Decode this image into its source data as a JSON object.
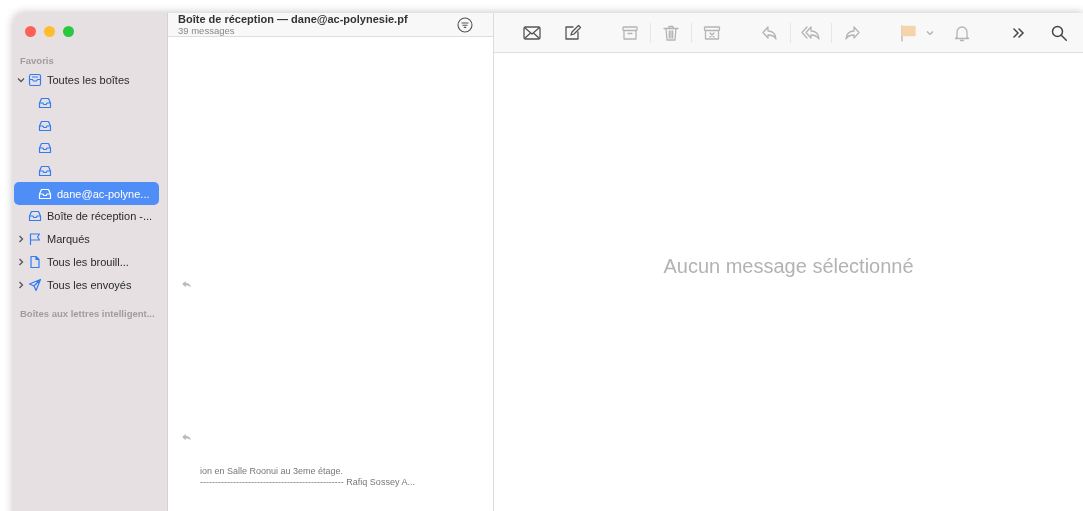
{
  "window": {
    "controls": [
      {
        "color": "#fe5f57"
      },
      {
        "color": "#febc2e"
      },
      {
        "color": "#28c840"
      }
    ]
  },
  "sidebar": {
    "section": "Favoris",
    "items": [
      {
        "kind": "all-inboxes",
        "label": "Toutes les boîtes",
        "expanded": true,
        "selected": false,
        "children": [
          {
            "selected": false
          },
          {
            "selected": false
          },
          {
            "selected": false
          },
          {
            "selected": false
          },
          {
            "label": "dane@ac-polyne...",
            "selected": true
          }
        ]
      },
      {
        "kind": "inbox",
        "label": "Boîte de réception -...",
        "selected": false
      },
      {
        "kind": "flag",
        "label": "Marqués",
        "expanded": false,
        "selected": false
      },
      {
        "kind": "draft",
        "label": "Tous les brouill...",
        "expanded": false,
        "selected": false
      },
      {
        "kind": "sent",
        "label": "Tous les envoyés",
        "expanded": false,
        "selected": false
      }
    ],
    "section_2": "Boîtes aux lettres intelligent..."
  },
  "message_list": {
    "title": "Boîte de réception — dane@ac-polynesie.pf",
    "count": "39 messages",
    "messages": [
      {
        "replied": true
      },
      {
        "replied": true,
        "preview": [
          "ion en Salle Roonui au 3eme étage.",
          "------------------------------------------------ Rafiq Sossey A..."
        ]
      }
    ]
  },
  "toolbar": [
    {
      "kind": "get-mail",
      "disabled": false
    },
    {
      "kind": "compose",
      "disabled": false
    },
    {
      "kind": "archive",
      "disabled": true
    },
    {
      "kind": "trash",
      "disabled": true
    },
    {
      "kind": "junk",
      "disabled": true
    },
    {
      "kind": "reply",
      "disabled": true
    },
    {
      "kind": "reply-all",
      "disabled": true
    },
    {
      "kind": "forward",
      "disabled": true
    },
    {
      "kind": "flag",
      "disabled": true
    },
    {
      "kind": "notify",
      "disabled": true
    },
    {
      "kind": "more",
      "disabled": false
    },
    {
      "kind": "search",
      "disabled": false
    }
  ],
  "viewer": {
    "empty_text": "Aucun message sélectionné"
  }
}
